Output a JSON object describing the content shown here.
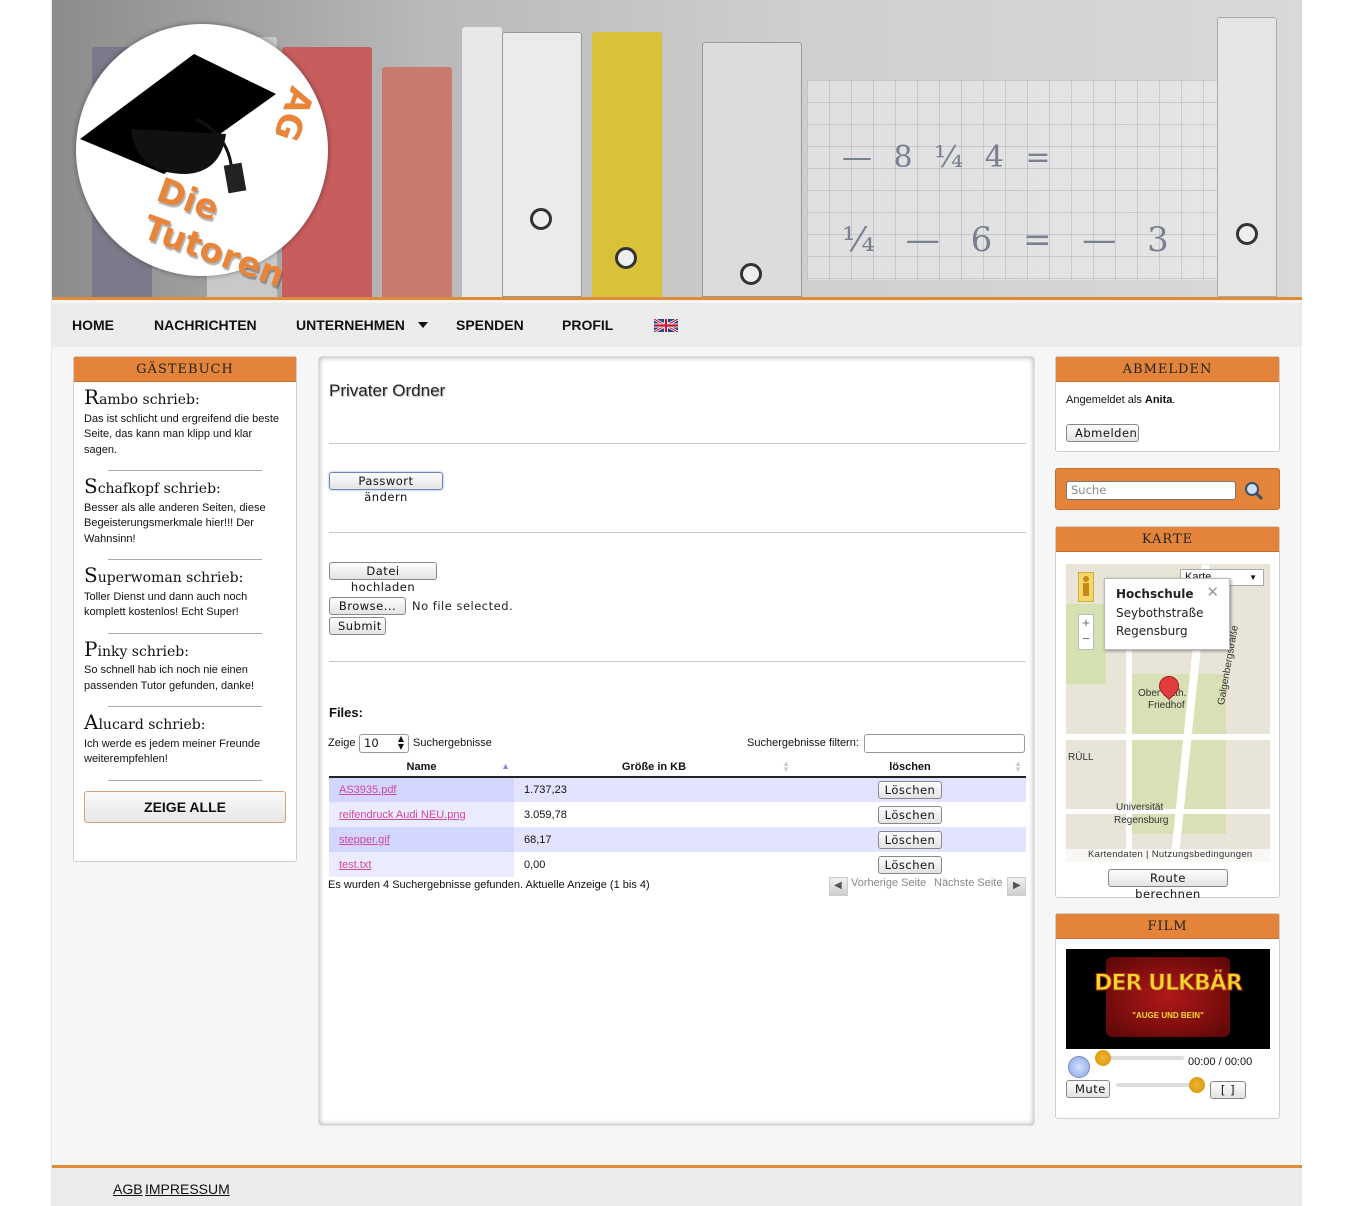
{
  "header": {
    "logo_text": "Die Tutoren",
    "logo_ag": "AG"
  },
  "nav": {
    "items": [
      {
        "label": "HOME"
      },
      {
        "label": "NACHRICHTEN"
      },
      {
        "label": "UNTERNEHMEN"
      },
      {
        "label": "SPENDEN"
      },
      {
        "label": "PROFIL"
      }
    ],
    "flag": "uk-flag-icon"
  },
  "guestbook": {
    "title": "GÄSTEBUCH",
    "entries": [
      {
        "initial": "R",
        "name_rest": "ambo schrieb:",
        "text": "Das ist schlicht und ergreifend die beste Seite, das kann man klipp und klar sagen."
      },
      {
        "initial": "S",
        "name_rest": "chafkopf schrieb:",
        "text": "Besser als alle anderen Seiten, diese Begeisterungsmerkmale hier!!! Der Wahnsinn!"
      },
      {
        "initial": "S",
        "name_rest": "uperwoman schrieb:",
        "text": "Toller Dienst und dann auch noch komplett kostenlos! Echt Super!"
      },
      {
        "initial": "P",
        "name_rest": "inky schrieb:",
        "text": "So schnell hab ich noch nie einen passenden Tutor gefunden, danke!"
      },
      {
        "initial": "A",
        "name_rest": "lucard schrieb:",
        "text": "Ich werde es jedem meiner Freunde weiterempfehlen!"
      }
    ],
    "show_all": "ZEIGE ALLE"
  },
  "main": {
    "title": "Privater Ordner",
    "change_password": "Passwort ändern",
    "upload_file": "Datei hochladen",
    "browse": "Browse...",
    "no_file": "No file selected.",
    "submit": "Submit",
    "files_title": "Files:",
    "show_label": "Zeige",
    "show_value": "10",
    "results_label": "Suchergebnisse",
    "filter_label": "Suchergebnisse filtern:",
    "columns": [
      "Name",
      "Größe in KB",
      "löschen"
    ],
    "rows": [
      {
        "name": "AS3935.pdf",
        "size": "1.737,23",
        "action": "Löschen"
      },
      {
        "name": "reifendruck Audi NEU.png",
        "size": "3.059,78",
        "action": "Löschen"
      },
      {
        "name": "stepper.gif",
        "size": "68,17",
        "action": "Löschen"
      },
      {
        "name": "test.txt",
        "size": "0,00",
        "action": "Löschen"
      }
    ],
    "info": "Es wurden 4 Suchergebnisse gefunden. Aktuelle Anzeige (1 bis 4)",
    "prev": "Vorherige Seite",
    "next": "Nächste Seite"
  },
  "logout": {
    "title": "ABMELDEN",
    "logged_in_prefix": "Angemeldet als ",
    "user": "Anita",
    "suffix": ".",
    "button": "Abmelden"
  },
  "search": {
    "placeholder": "Suche"
  },
  "map": {
    "title": "KARTE",
    "type": "Karte",
    "info_title": "Hochschule",
    "info_line1": "Seybothstraße",
    "info_line2": "Regensburg",
    "labels": [
      "Ober Kath.",
      "Friedhof",
      "Galgenbergstraße",
      "RÜLL",
      "Universität",
      "Regensburg"
    ],
    "footer_data": "Kartendaten",
    "footer_terms": "Nutzungsbedingungen",
    "route": "Route berechnen"
  },
  "film": {
    "title": "FILM",
    "video_title": "DER ULKBÄR",
    "video_sub": "\"AUGE UND BEIN\"",
    "time": "00:00 / 00:00",
    "mute": "Mute",
    "fullscreen": "[ ]"
  },
  "footer": {
    "agb": "AGB",
    "impressum": "IMPRESSUM"
  }
}
